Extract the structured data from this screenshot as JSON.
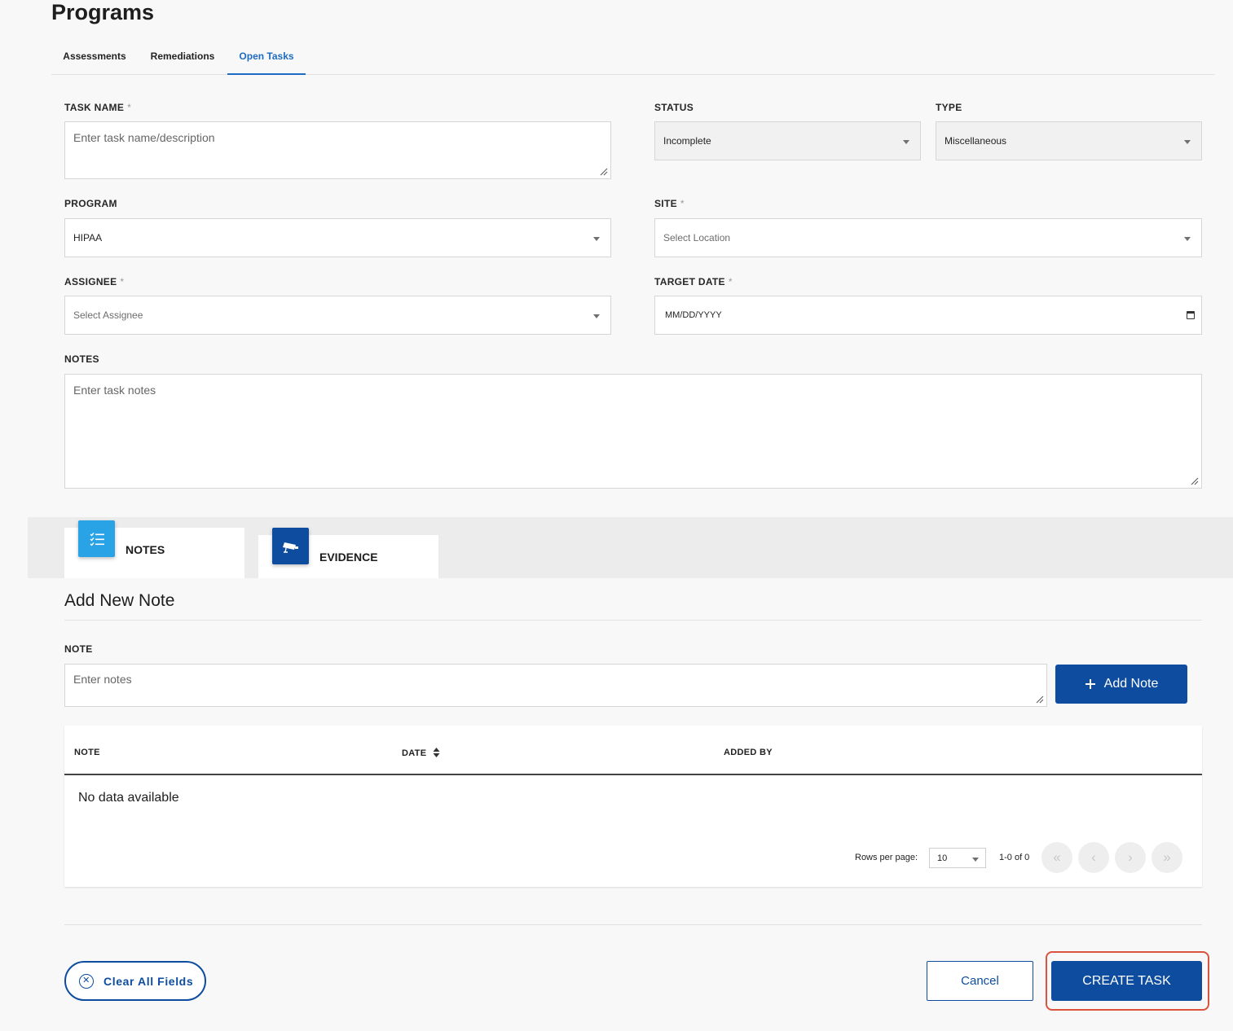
{
  "page": {
    "title": "Programs"
  },
  "tabs": [
    "Assessments",
    "Remediations",
    "Open Tasks"
  ],
  "form": {
    "task_name": {
      "label": "TASK NAME",
      "required": "*",
      "placeholder": "Enter task name/description"
    },
    "status": {
      "label": "STATUS",
      "value": "Incomplete"
    },
    "type": {
      "label": "TYPE",
      "value": "Miscellaneous"
    },
    "program": {
      "label": "PROGRAM",
      "value": "HIPAA"
    },
    "site": {
      "label": "SITE",
      "required": "*",
      "placeholder": "Select Location"
    },
    "assignee": {
      "label": "ASSIGNEE",
      "required": "*",
      "placeholder": "Select Assignee"
    },
    "target_date": {
      "label": "TARGET DATE",
      "required": "*",
      "placeholder": "MM/DD/YYYY"
    },
    "notes": {
      "label": "NOTES",
      "placeholder": "Enter task notes"
    }
  },
  "card_tabs": {
    "notes": {
      "label": "NOTES",
      "icon": "checklist-icon",
      "color": "#29a3e6"
    },
    "evidence": {
      "label": "EVIDENCE",
      "icon": "camera-icon",
      "color": "#0d4c9e"
    }
  },
  "add_note": {
    "title": "Add New Note",
    "note_label": "NOTE",
    "note_placeholder": "Enter notes",
    "button_label": "Add Note",
    "button_icon": "plus-icon"
  },
  "table": {
    "columns": [
      "NOTE",
      "DATE",
      "ADDED BY"
    ],
    "sort_icon": "sort-icon",
    "empty_text": "No data available",
    "rows_per_page_label": "Rows per page:",
    "rows_per_page_value": "10",
    "range_text": "1-0 of 0",
    "pagination_icons": [
      "first-page-icon",
      "prev-page-icon",
      "next-page-icon",
      "last-page-icon"
    ]
  },
  "footer": {
    "clear_label": "Clear All Fields",
    "cancel_label": "Cancel",
    "create_label": "CREATE TASK"
  },
  "colors": {
    "primary": "#0d4c9e",
    "accent_tab": "#1e6bc2",
    "highlight": "#d9533e"
  }
}
